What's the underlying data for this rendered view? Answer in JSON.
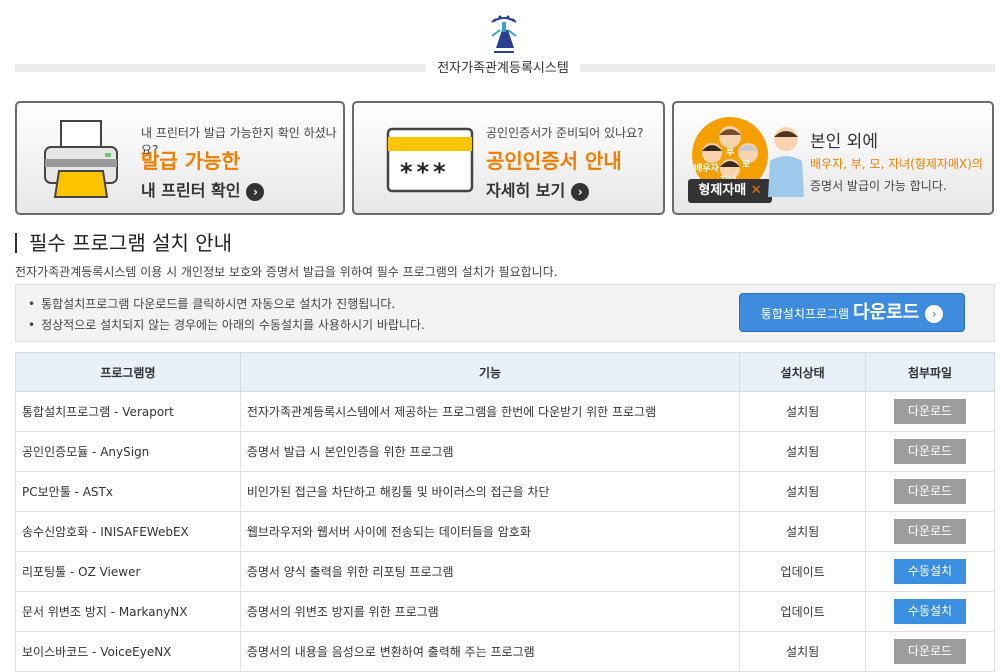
{
  "site": {
    "title": "전자가족관계등록시스템"
  },
  "cards": [
    {
      "small": "내 프린터가 발급 가능한지 확인 하셨나요?",
      "big": "발급 가능한",
      "sub": "내 프린터 확인"
    },
    {
      "small": "공인인증서가 준비되어 있나요?",
      "big": "공인인증서 안내",
      "sub": "자세히 보기",
      "stars": "***"
    },
    {
      "head": "본인 외에",
      "line1": "배우자, 부, 모, 자녀(형제자매X)의",
      "line2": "증명서 발급이 가능 합니다.",
      "badge": "형제자매",
      "badge_x": "✕",
      "faces": [
        "배우자",
        "부",
        "모",
        "자녀"
      ]
    }
  ],
  "section": {
    "title": "필수 프로그램 설치 안내",
    "desc": "전자가족관계등록시스템 이용 시 개인정보 보호와 증명서 발급을 위하여 필수 프로그램의 설치가 필요합니다.",
    "notices": [
      "통합설치프로그램 다운로드를 클릭하시면 자동으로 설치가 진행됩니다.",
      "정상적으로 설치되지 않는 경우에는 아래의 수동설치를 사용하시기 바랍니다."
    ],
    "download_small": "통합설치프로그램",
    "download_big": "다운로드"
  },
  "table": {
    "headers": [
      "프로그램명",
      "기능",
      "설치상태",
      "첨부파일"
    ],
    "rows": [
      {
        "name": "통합설치프로그램 - Veraport",
        "func": "전자가족관계등록시스템에서 제공하는 프로그램을 한번에 다운받기 위한 프로그램",
        "status": "설치됨",
        "action": "다운로드",
        "style": "gray"
      },
      {
        "name": "공인인증모듈 - AnySign",
        "func": "증명서 발급 시 본인인증을 위한 프로그램",
        "status": "설치됨",
        "action": "다운로드",
        "style": "gray"
      },
      {
        "name": "PC보안툴 - ASTx",
        "func": "비인가된 접근을 차단하고 해킹툴 및 바이러스의 접근을 차단",
        "status": "설치됨",
        "action": "다운로드",
        "style": "gray"
      },
      {
        "name": "송수신암호화 - INISAFEWebEX",
        "func": "웹브라우저와 웹서버 사이에 전송되는 데이터들을 암호화",
        "status": "설치됨",
        "action": "다운로드",
        "style": "gray"
      },
      {
        "name": "리포팅툴 - OZ Viewer",
        "func": "증명서 양식 출력을 위한 리포팅 프로그램",
        "status": "업데이트",
        "action": "수동설치",
        "style": "blue"
      },
      {
        "name": "문서 위변조 방지 - MarkanyNX",
        "func": "증명서의 위변조 방지를 위한 프로그램",
        "status": "업데이트",
        "action": "수동설치",
        "style": "blue"
      },
      {
        "name": "보이스바코드 - VoiceEyeNX",
        "func": "증명서의 내용을 음성으로 변환하여 출력해 주는 프로그램",
        "status": "설치됨",
        "action": "다운로드",
        "style": "gray"
      }
    ]
  }
}
